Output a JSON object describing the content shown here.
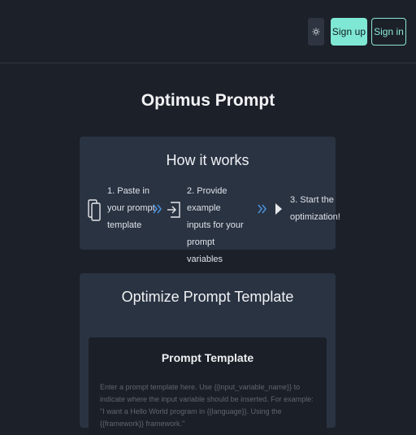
{
  "header": {
    "theme_icon": "sun-icon",
    "signup_label": "Sign up",
    "signin_label": "Sign in",
    "accent_color": "#7fe8d4"
  },
  "main": {
    "title": "Optimus Prompt",
    "how_it_works": {
      "title": "How it works",
      "steps": [
        {
          "icon": "document-copy-icon",
          "lines": [
            "1. Paste in",
            "your prompt",
            "template"
          ]
        },
        {
          "icon": "input-arrow-icon",
          "lines": [
            "2. Provide example",
            "inputs for your prompt",
            "variables"
          ]
        },
        {
          "icon": "play-icon",
          "lines": [
            "3. Start the",
            "optimization!"
          ]
        }
      ],
      "separator_icon": "double-chevron-right-icon"
    },
    "optimize": {
      "title": "Optimize Prompt Template",
      "template": {
        "title": "Prompt Template",
        "placeholder": "Enter a prompt template here. Use {{input_variable_name}} to indicate where the input variable should be inserted. For example: \"I want a Hello World program in {{language}}. Using the {{framework}} framework.\""
      }
    }
  }
}
